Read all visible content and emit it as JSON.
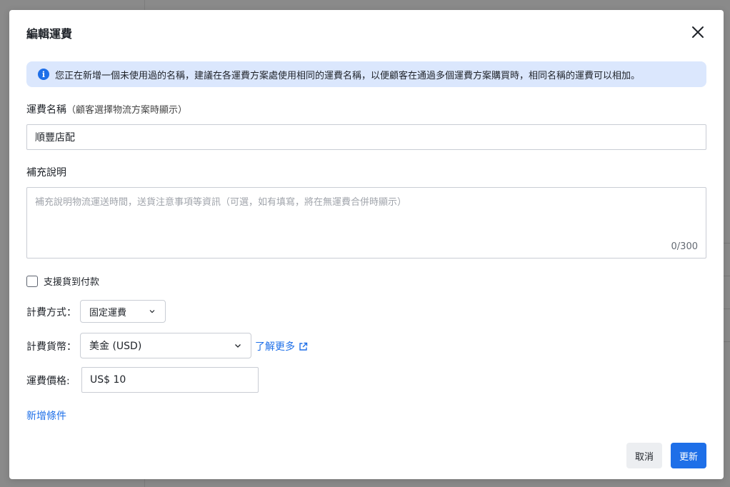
{
  "modal": {
    "title": "編輯運費"
  },
  "notice": {
    "text": "您正在新增一個未使用過的名稱，建議在各運費方案處使用相同的運費名稱，以便顧客在通過多個運費方案購買時，相同名稱的運費可以相加。"
  },
  "shipping_name": {
    "label": "運費名稱",
    "hint": "（顧客選擇物流方案時顯示）",
    "value": "順豐店配"
  },
  "description": {
    "label": "補充說明",
    "placeholder": "補充說明物流運送時間，送貨注意事項等資訊（可選，如有填寫，將在無運費合併時顯示）",
    "counter": "0/300"
  },
  "cod": {
    "label": "支援貨到付款",
    "checked": false
  },
  "billing_method": {
    "label": "計費方式：",
    "value": "固定運費"
  },
  "currency": {
    "label": "計費貨幣：",
    "value": "美金 (USD)",
    "learn_more": "了解更多"
  },
  "price": {
    "label": "運費價格:",
    "value": "US$ 10"
  },
  "add_condition": "新增條件",
  "buttons": {
    "cancel": "取消",
    "update": "更新"
  },
  "colors": {
    "primary": "#1e6fe8",
    "notice_bg": "#dbe7fd"
  }
}
